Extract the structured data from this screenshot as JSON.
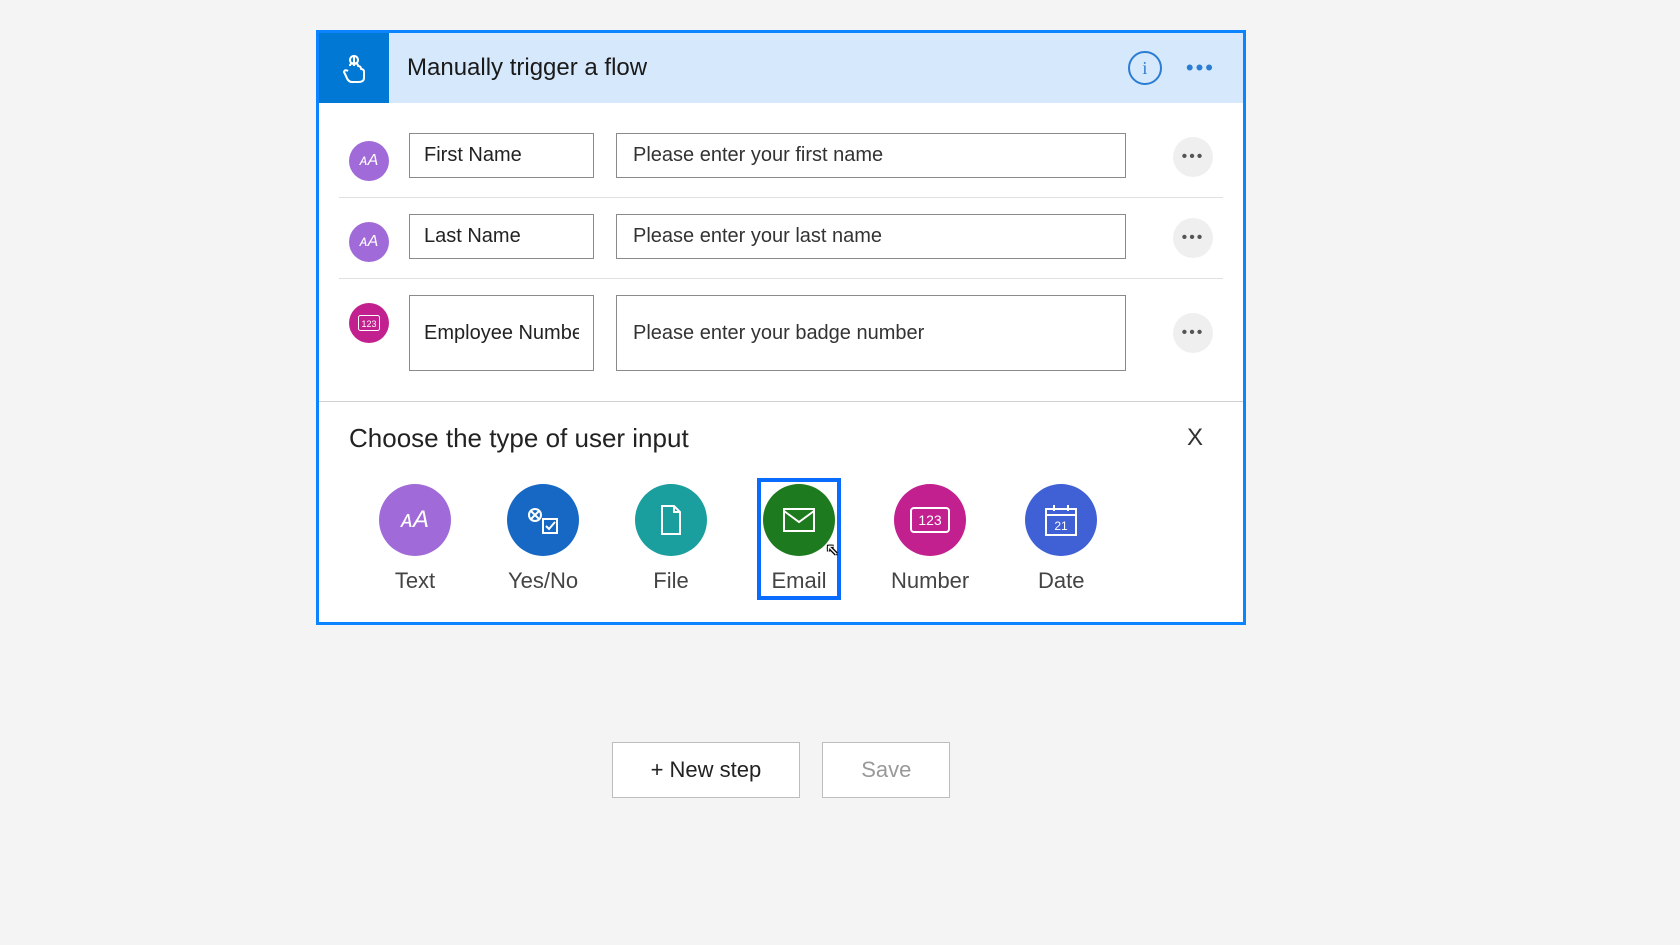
{
  "header": {
    "title": "Manually trigger a flow"
  },
  "inputs": [
    {
      "icon": "text",
      "label": "First Name",
      "placeholder": "Please enter your first name"
    },
    {
      "icon": "text",
      "label": "Last Name",
      "placeholder": "Please enter your last name"
    },
    {
      "icon": "number",
      "label": "Employee Number",
      "placeholder": "Please enter your badge number"
    }
  ],
  "choose_label": "Choose the type of user input",
  "close_label": "X",
  "types": [
    {
      "key": "text",
      "label": "Text",
      "color": "#a06ad8"
    },
    {
      "key": "yesno",
      "label": "Yes/No",
      "color": "#1668c4"
    },
    {
      "key": "file",
      "label": "File",
      "color": "#1a9e9e"
    },
    {
      "key": "email",
      "label": "Email",
      "color": "#1e7a1e",
      "selected": true
    },
    {
      "key": "number",
      "label": "Number",
      "color": "#c2208f"
    },
    {
      "key": "date",
      "label": "Date",
      "color": "#4060d6"
    }
  ],
  "footer": {
    "new_step": "+ New step",
    "save": "Save"
  }
}
